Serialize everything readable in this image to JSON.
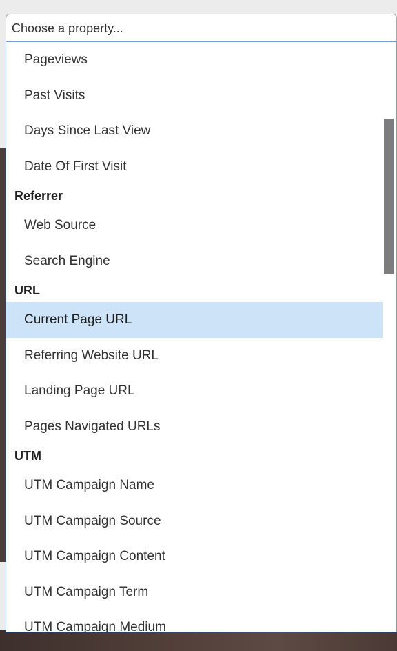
{
  "select": {
    "placeholder": "Choose a property..."
  },
  "dropdown": {
    "items": [
      {
        "type": "option",
        "label": "Pageviews"
      },
      {
        "type": "option",
        "label": "Past Visits"
      },
      {
        "type": "option",
        "label": "Days Since Last View"
      },
      {
        "type": "option",
        "label": "Date Of First Visit"
      },
      {
        "type": "group",
        "label": "Referrer"
      },
      {
        "type": "option",
        "label": "Web Source"
      },
      {
        "type": "option",
        "label": "Search Engine"
      },
      {
        "type": "group",
        "label": "URL"
      },
      {
        "type": "option",
        "label": "Current Page URL",
        "selected": true
      },
      {
        "type": "option",
        "label": "Referring Website URL"
      },
      {
        "type": "option",
        "label": "Landing Page URL"
      },
      {
        "type": "option",
        "label": "Pages Navigated URLs"
      },
      {
        "type": "group",
        "label": "UTM"
      },
      {
        "type": "option",
        "label": "UTM Campaign Name"
      },
      {
        "type": "option",
        "label": "UTM Campaign Source"
      },
      {
        "type": "option",
        "label": "UTM Campaign Content"
      },
      {
        "type": "option",
        "label": "UTM Campaign Term"
      },
      {
        "type": "option",
        "label": "UTM Campaign Medium"
      }
    ]
  },
  "colors": {
    "highlight": "#cde3f8",
    "dropdown_border": "#7a9cd3",
    "scrollbar_thumb": "#7d7d7d"
  }
}
